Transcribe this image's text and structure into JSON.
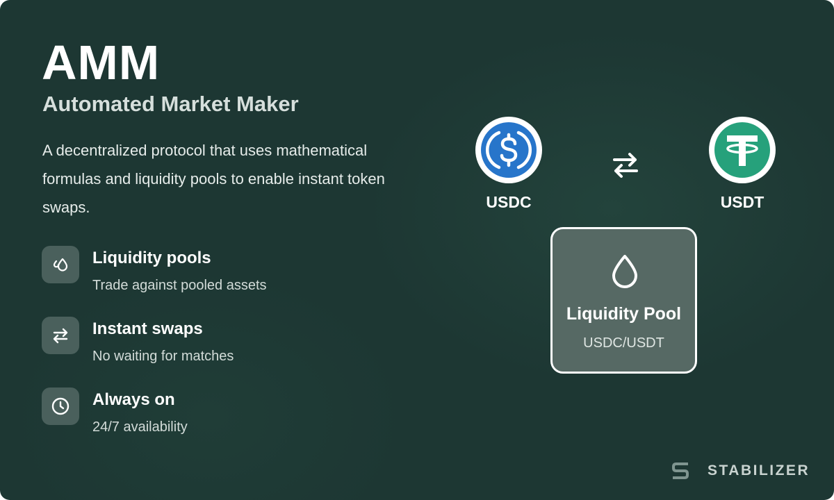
{
  "header": {
    "title": "AMM",
    "subtitle": "Automated Market Maker",
    "description": "A decentralized protocol that uses mathematical formulas and liquidity pools to enable instant token swaps."
  },
  "features": [
    {
      "icon": "liquidity-drops-icon",
      "title": "Liquidity pools",
      "subtitle": "Trade against pooled assets"
    },
    {
      "icon": "swap-arrows-icon",
      "title": "Instant swaps",
      "subtitle": "No waiting for matches"
    },
    {
      "icon": "clock-icon",
      "title": "Always on",
      "subtitle": "24/7 availability"
    }
  ],
  "diagram": {
    "token_a": {
      "label": "USDC",
      "icon": "usdc-icon",
      "color": "#2775CA"
    },
    "token_b": {
      "label": "USDT",
      "icon": "usdt-icon",
      "color": "#26A17B"
    },
    "swap_icon": "swap-arrows-icon",
    "pool": {
      "icon": "droplet-icon",
      "title": "Liquidity Pool",
      "pair": "USDC/USDT"
    }
  },
  "brand": {
    "name": "STABILIZER",
    "icon": "stabilizer-logo-icon"
  },
  "colors": {
    "background": "#1d3733",
    "icon_tile": "#4a605c",
    "pool_fill": "#566964",
    "text_primary": "#ffffff"
  }
}
